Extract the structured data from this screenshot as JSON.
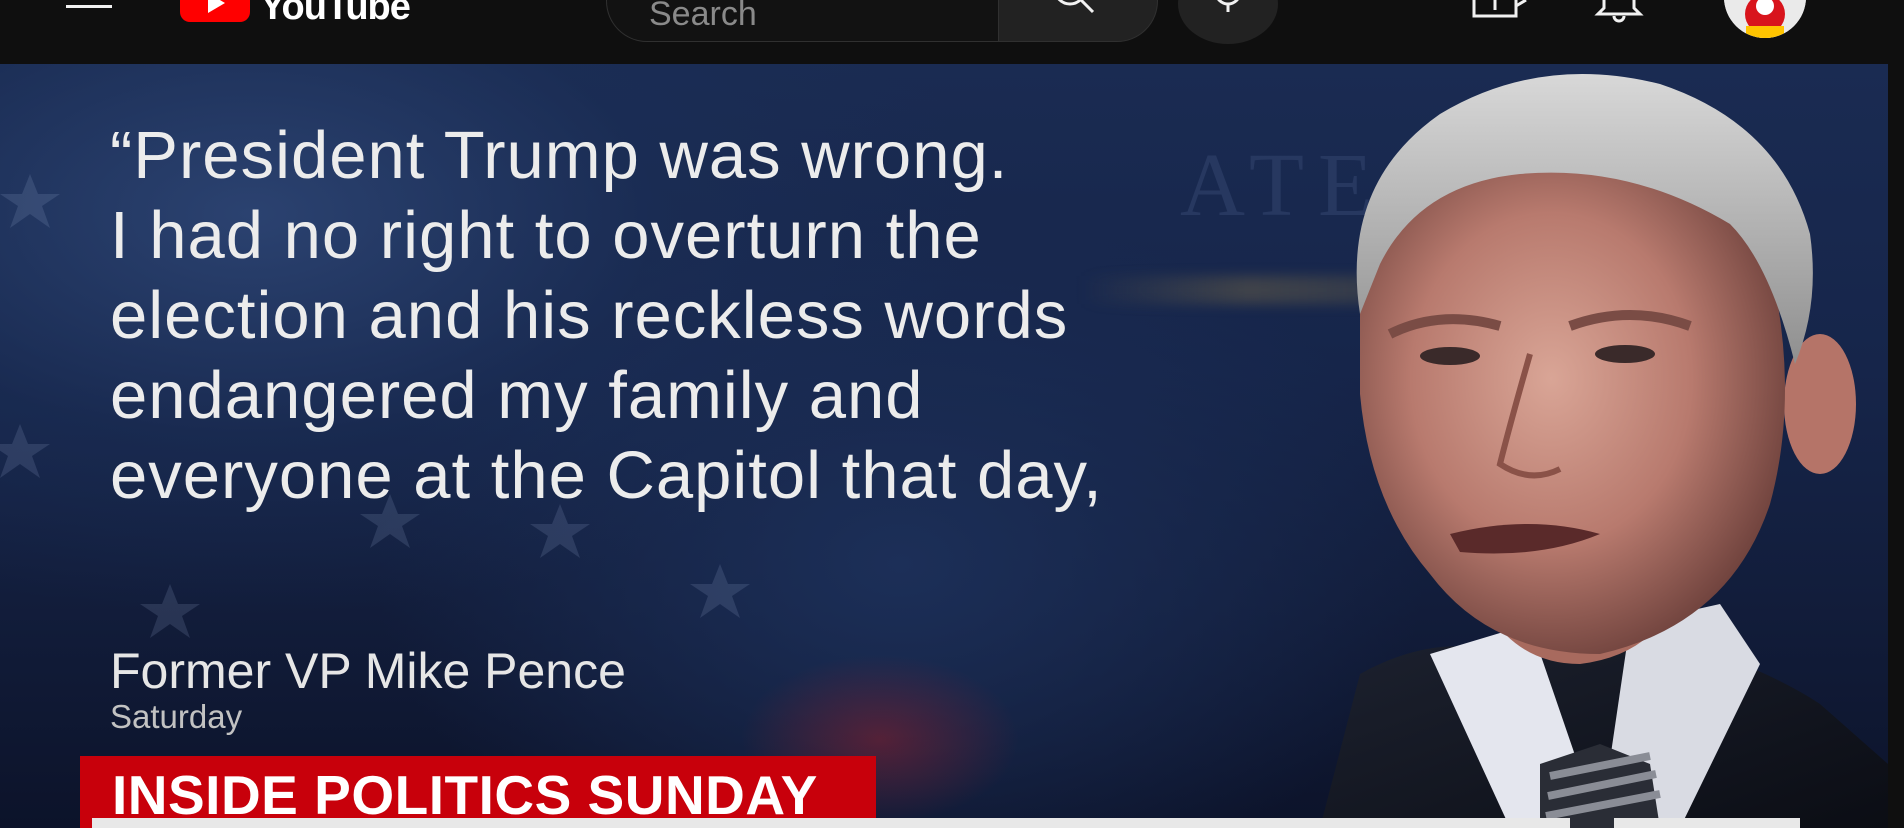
{
  "app": {
    "logo_text": "YouTube"
  },
  "search": {
    "placeholder": "Search"
  },
  "video": {
    "quote_lines": [
      "“President Trump was wrong.",
      "I had no right to overturn the",
      "election and his reckless words",
      "endangered my family and",
      "everyone at the Capitol that day,"
    ],
    "speaker": "Former VP Mike Pence",
    "date": "Saturday",
    "show_title": "INSIDE POLITICS SUNDAY"
  },
  "colors": {
    "brand_red": "#ff0000",
    "lower_third_red": "#c8000b",
    "topbar_bg": "#0f0f0f"
  },
  "icons": [
    "menu-icon",
    "youtube-logo",
    "search-icon",
    "mic-icon",
    "create-video-icon",
    "bell-icon",
    "avatar"
  ]
}
